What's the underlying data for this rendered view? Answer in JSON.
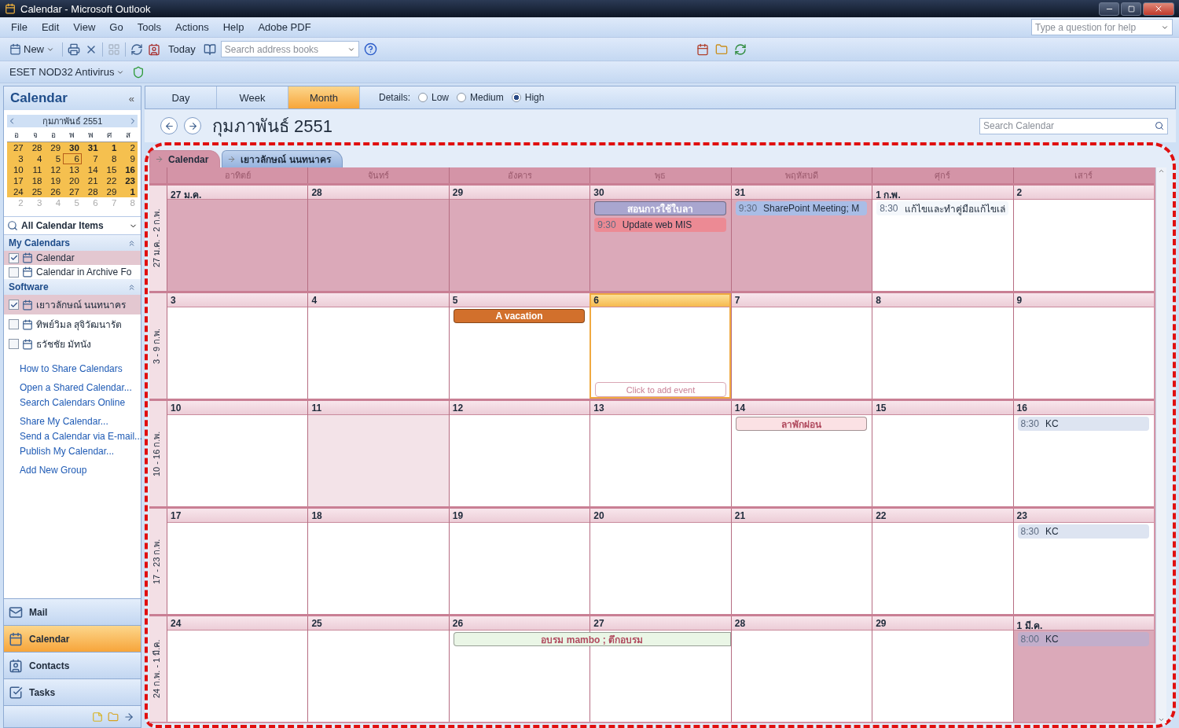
{
  "window": {
    "title": "Calendar - Microsoft Outlook"
  },
  "menu": [
    "File",
    "Edit",
    "View",
    "Go",
    "Tools",
    "Actions",
    "Help",
    "Adobe PDF"
  ],
  "help_field": {
    "placeholder": "Type a question for help"
  },
  "toolbar": {
    "new_label": "New",
    "today_label": "Today",
    "address_search": {
      "placeholder": "Search address books"
    }
  },
  "addin_toolbar": {
    "label": "ESET NOD32 Antivirus"
  },
  "sidebar": {
    "title": "Calendar",
    "collapse": "«",
    "mini_calendar": {
      "month": "กุมภาพันธ์ 2551",
      "weekdays": [
        "อ",
        "จ",
        "อ",
        "พ",
        "พ",
        "ศ",
        "ส"
      ],
      "weeks": [
        {
          "in_range": true,
          "days": [
            {
              "label": "27",
              "busy": false,
              "today": false
            },
            {
              "label": "28",
              "busy": false,
              "today": false
            },
            {
              "label": "29",
              "busy": false,
              "today": false
            },
            {
              "label": "30",
              "busy": true,
              "today": false
            },
            {
              "label": "31",
              "busy": true,
              "today": false
            },
            {
              "label": "1",
              "busy": true,
              "today": false
            },
            {
              "label": "2",
              "busy": false,
              "today": false
            }
          ]
        },
        {
          "in_range": true,
          "days": [
            {
              "label": "3",
              "busy": false,
              "today": false
            },
            {
              "label": "4",
              "busy": false,
              "today": false
            },
            {
              "label": "5",
              "busy": false,
              "today": false
            },
            {
              "label": "6",
              "busy": false,
              "today": true
            },
            {
              "label": "7",
              "busy": false,
              "today": false
            },
            {
              "label": "8",
              "busy": false,
              "today": false
            },
            {
              "label": "9",
              "busy": false,
              "today": false
            }
          ]
        },
        {
          "in_range": true,
          "days": [
            {
              "label": "10",
              "busy": false,
              "today": false
            },
            {
              "label": "11",
              "busy": false,
              "today": false
            },
            {
              "label": "12",
              "busy": false,
              "today": false
            },
            {
              "label": "13",
              "busy": false,
              "today": false
            },
            {
              "label": "14",
              "busy": false,
              "today": false
            },
            {
              "label": "15",
              "busy": false,
              "today": false
            },
            {
              "label": "16",
              "busy": true,
              "today": false
            }
          ]
        },
        {
          "in_range": true,
          "days": [
            {
              "label": "17",
              "busy": false,
              "today": false
            },
            {
              "label": "18",
              "busy": false,
              "today": false
            },
            {
              "label": "19",
              "busy": false,
              "today": false
            },
            {
              "label": "20",
              "busy": false,
              "today": false
            },
            {
              "label": "21",
              "busy": false,
              "today": false
            },
            {
              "label": "22",
              "busy": false,
              "today": false
            },
            {
              "label": "23",
              "busy": true,
              "today": false
            }
          ]
        },
        {
          "in_range": true,
          "days": [
            {
              "label": "24",
              "busy": false,
              "today": false
            },
            {
              "label": "25",
              "busy": false,
              "today": false
            },
            {
              "label": "26",
              "busy": false,
              "today": false
            },
            {
              "label": "27",
              "busy": false,
              "today": false
            },
            {
              "label": "28",
              "busy": false,
              "today": false
            },
            {
              "label": "29",
              "busy": false,
              "today": false
            },
            {
              "label": "1",
              "busy": true,
              "today": false
            }
          ]
        },
        {
          "in_range": false,
          "days": [
            {
              "label": "2",
              "busy": false,
              "today": false
            },
            {
              "label": "3",
              "busy": false,
              "today": false
            },
            {
              "label": "4",
              "busy": false,
              "today": false
            },
            {
              "label": "5",
              "busy": false,
              "today": false
            },
            {
              "label": "6",
              "busy": false,
              "today": false
            },
            {
              "label": "7",
              "busy": false,
              "today": false
            },
            {
              "label": "8",
              "busy": false,
              "today": false
            }
          ]
        }
      ]
    },
    "filter": "All Calendar Items",
    "groups": [
      {
        "title": "My Calendars",
        "items": [
          {
            "label": "Calendar",
            "checked": true,
            "selected": true
          },
          {
            "label": "Calendar in Archive Fo",
            "checked": false,
            "selected": false
          }
        ]
      },
      {
        "title": "Software",
        "items": [
          {
            "label": "เยาวลักษณ์ นนทนาคร",
            "checked": true,
            "selected": true
          },
          {
            "label": "ทิพย์วิมล สุจิวัฒนารัต",
            "checked": false,
            "selected": false
          },
          {
            "label": "ธวัชชัย มัทนัง",
            "checked": false,
            "selected": false
          }
        ]
      }
    ],
    "links": [
      [
        "How to Share Calendars"
      ],
      [
        "Open a Shared Calendar...",
        "Search Calendars Online"
      ],
      [
        "Share My Calendar...",
        "Send a Calendar via E-mail...",
        "Publish My Calendar..."
      ],
      [
        "Add New Group"
      ]
    ],
    "nav": [
      {
        "label": "Mail",
        "kind": "mail",
        "selected": false
      },
      {
        "label": "Calendar",
        "kind": "calendar",
        "selected": true
      },
      {
        "label": "Contacts",
        "kind": "contacts",
        "selected": false
      },
      {
        "label": "Tasks",
        "kind": "tasks",
        "selected": false
      }
    ]
  },
  "view_tabs": [
    {
      "label": "Day",
      "selected": false
    },
    {
      "label": "Week",
      "selected": false
    },
    {
      "label": "Month",
      "selected": true
    }
  ],
  "details": {
    "label": "Details:",
    "options": [
      {
        "label": "Low",
        "selected": false
      },
      {
        "label": "Medium",
        "selected": false
      },
      {
        "label": "High",
        "selected": true
      }
    ]
  },
  "month_title": "กุมภาพันธ์ 2551",
  "calendar_search": {
    "placeholder": "Search Calendar"
  },
  "calendar_tabs": [
    {
      "label": "Calendar",
      "selected": true
    },
    {
      "label": "เยาวลักษณ์ นนทนาคร",
      "selected": false
    }
  ],
  "weekdays": [
    "อาทิตย์",
    "จันทร์",
    "อังคาร",
    "พุธ",
    "พฤหัสบดี",
    "ศุกร์",
    "เสาร์"
  ],
  "weeks": [
    {
      "range": "27 ม.ค. - 2 ก.พ.",
      "days": [
        {
          "label": "27 ม.ค.",
          "other_month": true,
          "selected": false,
          "today": false
        },
        {
          "label": "28",
          "other_month": true,
          "selected": false,
          "today": false
        },
        {
          "label": "29",
          "other_month": true,
          "selected": false,
          "today": false
        },
        {
          "label": "30",
          "other_month": true,
          "selected": false,
          "today": false,
          "events": [
            {
              "kind": "banner",
              "title": "สอนการใช้ใบลา",
              "color": "#a9a6cf",
              "continued": false
            },
            {
              "kind": "timed",
              "time": "9:30",
              "title": "Update web MIS",
              "color": "#ec8a94",
              "continued": false
            }
          ]
        },
        {
          "label": "31",
          "other_month": true,
          "selected": false,
          "today": false,
          "events": [
            {
              "kind": "timed",
              "time": "9:30",
              "title": "SharePoint Meeting; M",
              "color": "#a9bde6",
              "continued": false
            }
          ]
        },
        {
          "label": "1 ก.พ.",
          "other_month": false,
          "selected": false,
          "today": false,
          "events": [
            {
              "kind": "timed",
              "time": "8:30",
              "title": "แก้ไขและทำคู่มือแก้ไขเล่",
              "color": "#f4f7fb",
              "continued": false
            }
          ]
        },
        {
          "label": "2",
          "other_month": false,
          "selected": false,
          "today": false
        }
      ]
    },
    {
      "range": "3 - 9 ก.พ.",
      "days": [
        {
          "label": "3",
          "other_month": false,
          "selected": false,
          "today": false
        },
        {
          "label": "4",
          "other_month": false,
          "selected": false,
          "today": false
        },
        {
          "label": "5",
          "other_month": false,
          "selected": false,
          "today": false,
          "events": [
            {
              "kind": "banner",
              "title": "A vacation",
              "color": "#d2702c",
              "continued": false
            }
          ]
        },
        {
          "label": "6",
          "other_month": false,
          "selected": false,
          "today": true,
          "add_hint": "Click to add event"
        },
        {
          "label": "7",
          "other_month": false,
          "selected": false,
          "today": false
        },
        {
          "label": "8",
          "other_month": false,
          "selected": false,
          "today": false
        },
        {
          "label": "9",
          "other_month": false,
          "selected": false,
          "today": false
        }
      ]
    },
    {
      "range": "10 - 16 ก.พ.",
      "days": [
        {
          "label": "10",
          "other_month": false,
          "selected": false,
          "today": false
        },
        {
          "label": "11",
          "other_month": false,
          "selected": true,
          "today": false
        },
        {
          "label": "12",
          "other_month": false,
          "selected": false,
          "today": false
        },
        {
          "label": "13",
          "other_month": false,
          "selected": false,
          "today": false
        },
        {
          "label": "14",
          "other_month": false,
          "selected": false,
          "today": false,
          "events": [
            {
              "kind": "banner",
              "title": "ลาพักผ่อน",
              "color": "#fbe1e4",
              "continued": false
            }
          ]
        },
        {
          "label": "15",
          "other_month": false,
          "selected": false,
          "today": false
        },
        {
          "label": "16",
          "other_month": false,
          "selected": false,
          "today": false,
          "events": [
            {
              "kind": "timed",
              "time": "8:30",
              "title": "KC",
              "color": "#dde4f1",
              "continued": false
            }
          ]
        }
      ]
    },
    {
      "range": "17 - 23 ก.พ.",
      "days": [
        {
          "label": "17",
          "other_month": false,
          "selected": false,
          "today": false
        },
        {
          "label": "18",
          "other_month": false,
          "selected": false,
          "today": false
        },
        {
          "label": "19",
          "other_month": false,
          "selected": false,
          "today": false
        },
        {
          "label": "20",
          "other_month": false,
          "selected": false,
          "today": false
        },
        {
          "label": "21",
          "other_month": false,
          "selected": false,
          "today": false
        },
        {
          "label": "22",
          "other_month": false,
          "selected": false,
          "today": false
        },
        {
          "label": "23",
          "other_month": false,
          "selected": false,
          "today": false,
          "events": [
            {
              "kind": "timed",
              "time": "8:30",
              "title": "KC",
              "color": "#dde4f1",
              "continued": false
            }
          ]
        }
      ]
    },
    {
      "range": "24 ก.พ. - 1 มี.ค.",
      "days": [
        {
          "label": "24",
          "other_month": false,
          "selected": false,
          "today": false
        },
        {
          "label": "25",
          "other_month": false,
          "selected": false,
          "today": false
        },
        {
          "label": "26",
          "other_month": false,
          "selected": false,
          "today": false,
          "events": [
            {
              "kind": "banner",
              "title": "อบรม mambo ;  ตึกอบรม",
              "color": "#eaf6e6",
              "continued": true
            }
          ]
        },
        {
          "label": "27",
          "other_month": false,
          "selected": false,
          "today": false
        },
        {
          "label": "28",
          "other_month": false,
          "selected": false,
          "today": false
        },
        {
          "label": "29",
          "other_month": false,
          "selected": false,
          "today": false
        },
        {
          "label": "1 มี.ค.",
          "other_month": true,
          "selected": false,
          "today": false,
          "events": [
            {
              "kind": "timed",
              "time": "8:00",
              "title": "KC",
              "color": "#c2aecb",
              "continued": false
            }
          ]
        }
      ]
    }
  ]
}
